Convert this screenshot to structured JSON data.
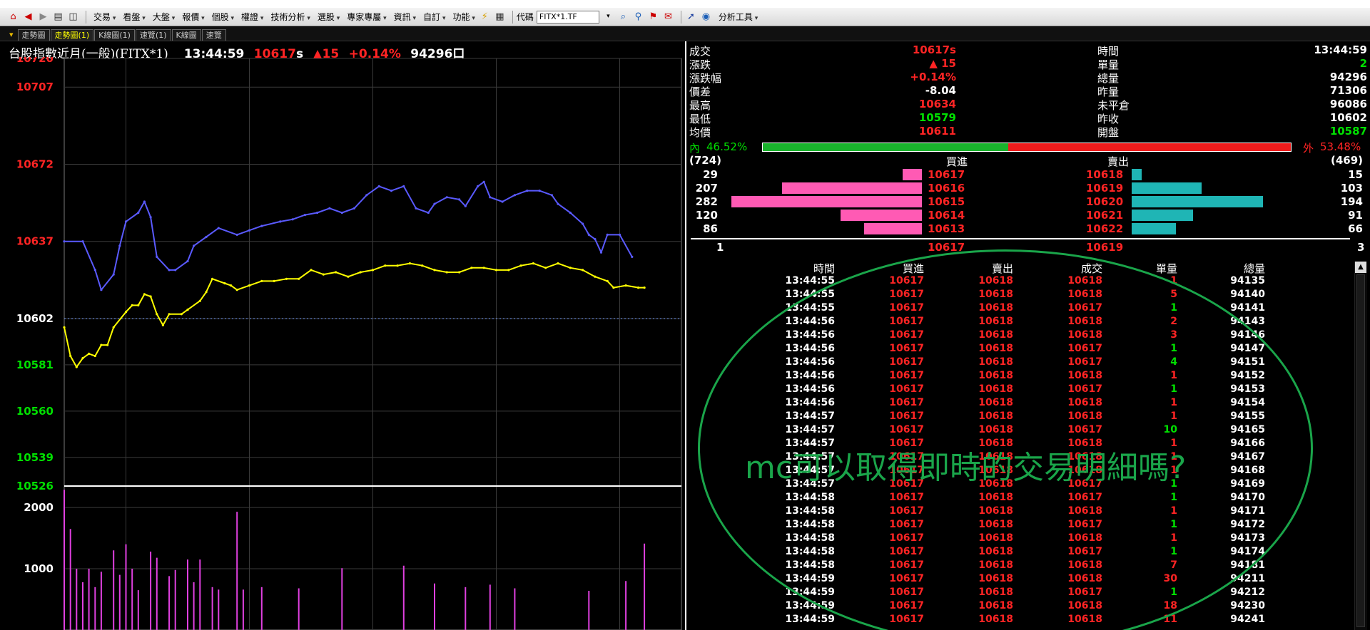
{
  "toolbar": {
    "menus": [
      "交易",
      "看盤",
      "大盤",
      "報價",
      "個股",
      "權證",
      "技術分析",
      "選股",
      "專家專屬",
      "資訊",
      "自訂",
      "功能"
    ],
    "code_label": "代碼",
    "code_value": "FITX*1.TF",
    "analysis_label": "分析工具"
  },
  "tabs": [
    {
      "label": "走勢圖",
      "active": false
    },
    {
      "label": "走勢圖(1)",
      "active": true
    },
    {
      "label": "K線圖(1)",
      "active": false
    },
    {
      "label": "速覽(1)",
      "active": false
    },
    {
      "label": "K線圖",
      "active": false
    },
    {
      "label": "速覽",
      "active": false
    }
  ],
  "chart_header": {
    "name": "台股指數近月(一般)(FITX*1)",
    "time": "13:44:59",
    "price": "10617",
    "price_suffix": "s",
    "change": "▲15",
    "change_pct": "+0.14%",
    "volume": "94296口"
  },
  "chart_data": {
    "type": "line",
    "x_label": "time",
    "price_ticks": [
      {
        "value": 10720,
        "color": "#ff2424"
      },
      {
        "value": 10707,
        "color": "#ff2424"
      },
      {
        "value": 10672,
        "color": "#ff2424"
      },
      {
        "value": 10637,
        "color": "#ff2424"
      },
      {
        "value": 10602,
        "color": "#ffffff"
      },
      {
        "value": 10581,
        "color": "#00e000"
      },
      {
        "value": 10560,
        "color": "#00e000"
      },
      {
        "value": 10539,
        "color": "#00e000"
      },
      {
        "value": 10526,
        "color": "#00e000"
      }
    ],
    "price_range": [
      10526,
      10720
    ],
    "reference_price": 10602,
    "volume_ticks": [
      2000,
      1000
    ],
    "volume_range": [
      0,
      2350
    ],
    "series": [
      {
        "color": "#5a5aff",
        "points": [
          [
            0,
            10637
          ],
          [
            0.03,
            10637
          ],
          [
            0.05,
            10624
          ],
          [
            0.06,
            10615
          ],
          [
            0.08,
            10622
          ],
          [
            0.09,
            10635
          ],
          [
            0.1,
            10646
          ],
          [
            0.12,
            10650
          ],
          [
            0.13,
            10655
          ],
          [
            0.14,
            10648
          ],
          [
            0.15,
            10630
          ],
          [
            0.17,
            10624
          ],
          [
            0.18,
            10624
          ],
          [
            0.2,
            10628
          ],
          [
            0.21,
            10635
          ],
          [
            0.23,
            10639
          ],
          [
            0.25,
            10643
          ],
          [
            0.28,
            10640
          ],
          [
            0.3,
            10642
          ],
          [
            0.32,
            10644
          ],
          [
            0.35,
            10646
          ],
          [
            0.37,
            10647
          ],
          [
            0.39,
            10649
          ],
          [
            0.41,
            10650
          ],
          [
            0.43,
            10652
          ],
          [
            0.45,
            10650
          ],
          [
            0.47,
            10652
          ],
          [
            0.49,
            10658
          ],
          [
            0.51,
            10662
          ],
          [
            0.53,
            10660
          ],
          [
            0.55,
            10662
          ],
          [
            0.57,
            10652
          ],
          [
            0.59,
            10650
          ],
          [
            0.6,
            10654
          ],
          [
            0.62,
            10657
          ],
          [
            0.64,
            10656
          ],
          [
            0.65,
            10653
          ],
          [
            0.67,
            10662
          ],
          [
            0.68,
            10664
          ],
          [
            0.69,
            10657
          ],
          [
            0.71,
            10655
          ],
          [
            0.73,
            10658
          ],
          [
            0.75,
            10660
          ],
          [
            0.77,
            10660
          ],
          [
            0.79,
            10658
          ],
          [
            0.8,
            10654
          ],
          [
            0.82,
            10650
          ],
          [
            0.84,
            10645
          ],
          [
            0.85,
            10640
          ],
          [
            0.86,
            10638
          ],
          [
            0.87,
            10632
          ],
          [
            0.88,
            10640
          ],
          [
            0.9,
            10640
          ],
          [
            0.92,
            10630
          ]
        ]
      },
      {
        "color": "#ffff00",
        "points": [
          [
            0,
            10598
          ],
          [
            0.01,
            10585
          ],
          [
            0.02,
            10580
          ],
          [
            0.03,
            10584
          ],
          [
            0.04,
            10586
          ],
          [
            0.05,
            10585
          ],
          [
            0.06,
            10590
          ],
          [
            0.07,
            10590
          ],
          [
            0.08,
            10598
          ],
          [
            0.1,
            10605
          ],
          [
            0.11,
            10608
          ],
          [
            0.12,
            10608
          ],
          [
            0.13,
            10613
          ],
          [
            0.14,
            10612
          ],
          [
            0.15,
            10604
          ],
          [
            0.16,
            10599
          ],
          [
            0.17,
            10604
          ],
          [
            0.19,
            10604
          ],
          [
            0.2,
            10606
          ],
          [
            0.22,
            10610
          ],
          [
            0.23,
            10614
          ],
          [
            0.24,
            10620
          ],
          [
            0.26,
            10618
          ],
          [
            0.27,
            10617
          ],
          [
            0.28,
            10615
          ],
          [
            0.3,
            10617
          ],
          [
            0.32,
            10619
          ],
          [
            0.34,
            10619
          ],
          [
            0.36,
            10620
          ],
          [
            0.38,
            10620
          ],
          [
            0.4,
            10624
          ],
          [
            0.42,
            10622
          ],
          [
            0.44,
            10623
          ],
          [
            0.46,
            10621
          ],
          [
            0.48,
            10623
          ],
          [
            0.5,
            10624
          ],
          [
            0.52,
            10626
          ],
          [
            0.54,
            10626
          ],
          [
            0.56,
            10627
          ],
          [
            0.58,
            10626
          ],
          [
            0.6,
            10624
          ],
          [
            0.62,
            10623
          ],
          [
            0.64,
            10623
          ],
          [
            0.66,
            10625
          ],
          [
            0.68,
            10625
          ],
          [
            0.7,
            10624
          ],
          [
            0.72,
            10624
          ],
          [
            0.74,
            10626
          ],
          [
            0.76,
            10627
          ],
          [
            0.78,
            10625
          ],
          [
            0.8,
            10627
          ],
          [
            0.82,
            10625
          ],
          [
            0.84,
            10624
          ],
          [
            0.86,
            10621
          ],
          [
            0.88,
            10619
          ],
          [
            0.89,
            10616
          ],
          [
            0.91,
            10617
          ],
          [
            0.93,
            10616
          ],
          [
            0.94,
            10616
          ]
        ]
      }
    ],
    "volume_series": {
      "color": "#e040e0",
      "points": [
        [
          0,
          2290
        ],
        [
          0.01,
          1650
        ],
        [
          0.02,
          1000
        ],
        [
          0.03,
          780
        ],
        [
          0.04,
          1000
        ],
        [
          0.05,
          700
        ],
        [
          0.06,
          950
        ],
        [
          0.08,
          1300
        ],
        [
          0.09,
          900
        ],
        [
          0.1,
          1400
        ],
        [
          0.11,
          1000
        ],
        [
          0.12,
          650
        ],
        [
          0.14,
          1280
        ],
        [
          0.15,
          1180
        ],
        [
          0.17,
          880
        ],
        [
          0.18,
          980
        ],
        [
          0.2,
          1150
        ],
        [
          0.21,
          780
        ],
        [
          0.22,
          1150
        ],
        [
          0.24,
          700
        ],
        [
          0.25,
          660
        ],
        [
          0.28,
          1930
        ],
        [
          0.29,
          660
        ],
        [
          0.32,
          700
        ],
        [
          0.38,
          680
        ],
        [
          0.45,
          1010
        ],
        [
          0.55,
          1050
        ],
        [
          0.6,
          760
        ],
        [
          0.65,
          700
        ],
        [
          0.69,
          740
        ],
        [
          0.73,
          680
        ],
        [
          0.85,
          640
        ],
        [
          0.91,
          800
        ],
        [
          0.94,
          1410
        ]
      ]
    }
  },
  "quote": {
    "left": [
      {
        "label": "成交",
        "value": "10617s",
        "color": "red"
      },
      {
        "label": "漲跌",
        "value": "▲ 15",
        "color": "red"
      },
      {
        "label": "漲跌幅",
        "value": "+0.14%",
        "color": "red"
      },
      {
        "label": "價差",
        "value": "-8.04",
        "color": "white"
      },
      {
        "label": "最高",
        "value": "10634",
        "color": "red"
      },
      {
        "label": "最低",
        "value": "10579",
        "color": "green"
      },
      {
        "label": "均價",
        "value": "10611",
        "color": "red"
      }
    ],
    "right": [
      {
        "label": "時間",
        "value": "13:44:59",
        "color": "white"
      },
      {
        "label": "單量",
        "value": "2",
        "color": "green"
      },
      {
        "label": "總量",
        "value": "94296",
        "color": "white"
      },
      {
        "label": "昨量",
        "value": "71306",
        "color": "white"
      },
      {
        "label": "未平倉",
        "value": "96086",
        "color": "white"
      },
      {
        "label": "昨收",
        "value": "10602",
        "color": "white"
      },
      {
        "label": "開盤",
        "value": "10587",
        "color": "green"
      }
    ]
  },
  "ratio": {
    "inner_label": "內",
    "inner_pct": "46.52%",
    "inner_fraction": 0.4652,
    "outer_label": "外",
    "outer_pct": "53.48%"
  },
  "orderbook": {
    "bid_total": "(724)",
    "ask_total": "(469)",
    "bid_header": "買進",
    "ask_header": "賣出",
    "rows": [
      {
        "bid_vol": "29",
        "bid_px": "10617",
        "ask_px": "10618",
        "ask_vol": "15",
        "bid_n": 29,
        "ask_n": 15
      },
      {
        "bid_vol": "207",
        "bid_px": "10616",
        "ask_px": "10619",
        "ask_vol": "103",
        "bid_n": 207,
        "ask_n": 103
      },
      {
        "bid_vol": "282",
        "bid_px": "10615",
        "ask_px": "10620",
        "ask_vol": "194",
        "bid_n": 282,
        "ask_n": 194
      },
      {
        "bid_vol": "120",
        "bid_px": "10614",
        "ask_px": "10621",
        "ask_vol": "91",
        "bid_n": 120,
        "ask_n": 91
      },
      {
        "bid_vol": "86",
        "bid_px": "10613",
        "ask_px": "10622",
        "ask_vol": "66",
        "bid_n": 86,
        "ask_n": 66
      }
    ],
    "last_bid_vol": "1",
    "last_bid_px": "10617",
    "last_ask_px": "10619",
    "last_ask_vol": "3",
    "scale_max": 282
  },
  "ticks": {
    "headers": [
      "時間",
      "買進",
      "賣出",
      "成交",
      "單量",
      "總量"
    ],
    "rows": [
      [
        "13:44:55",
        "10617",
        "10618",
        "10618",
        "1",
        "94135"
      ],
      [
        "13:44:55",
        "10617",
        "10618",
        "10618",
        "5",
        "94140"
      ],
      [
        "13:44:55",
        "10617",
        "10618",
        "10617",
        "1",
        "94141"
      ],
      [
        "13:44:56",
        "10617",
        "10618",
        "10618",
        "2",
        "94143"
      ],
      [
        "13:44:56",
        "10617",
        "10618",
        "10618",
        "3",
        "94146"
      ],
      [
        "13:44:56",
        "10617",
        "10618",
        "10617",
        "1",
        "94147"
      ],
      [
        "13:44:56",
        "10617",
        "10618",
        "10617",
        "4",
        "94151"
      ],
      [
        "13:44:56",
        "10617",
        "10618",
        "10618",
        "1",
        "94152"
      ],
      [
        "13:44:56",
        "10617",
        "10618",
        "10617",
        "1",
        "94153"
      ],
      [
        "13:44:56",
        "10617",
        "10618",
        "10618",
        "1",
        "94154"
      ],
      [
        "13:44:57",
        "10617",
        "10618",
        "10618",
        "1",
        "94155"
      ],
      [
        "13:44:57",
        "10617",
        "10618",
        "10617",
        "10",
        "94165"
      ],
      [
        "13:44:57",
        "10617",
        "10618",
        "10618",
        "1",
        "94166"
      ],
      [
        "13:44:57",
        "10617",
        "10618",
        "10618",
        "1",
        "94167"
      ],
      [
        "13:44:57",
        "10617",
        "10618",
        "10618",
        "1",
        "94168"
      ],
      [
        "13:44:57",
        "10617",
        "10618",
        "10617",
        "1",
        "94169"
      ],
      [
        "13:44:58",
        "10617",
        "10618",
        "10617",
        "1",
        "94170"
      ],
      [
        "13:44:58",
        "10617",
        "10618",
        "10618",
        "1",
        "94171"
      ],
      [
        "13:44:58",
        "10617",
        "10618",
        "10617",
        "1",
        "94172"
      ],
      [
        "13:44:58",
        "10617",
        "10618",
        "10618",
        "1",
        "94173"
      ],
      [
        "13:44:58",
        "10617",
        "10618",
        "10617",
        "1",
        "94174"
      ],
      [
        "13:44:58",
        "10617",
        "10618",
        "10618",
        "7",
        "94181"
      ],
      [
        "13:44:59",
        "10617",
        "10618",
        "10618",
        "30",
        "94211"
      ],
      [
        "13:44:59",
        "10617",
        "10618",
        "10617",
        "1",
        "94212"
      ],
      [
        "13:44:59",
        "10617",
        "10618",
        "10618",
        "18",
        "94230"
      ],
      [
        "13:44:59",
        "10617",
        "10618",
        "10618",
        "11",
        "94241"
      ]
    ]
  },
  "annotation": {
    "text": "mc可以取得即時的交易明細嗎?",
    "color": "#1aa54a"
  }
}
